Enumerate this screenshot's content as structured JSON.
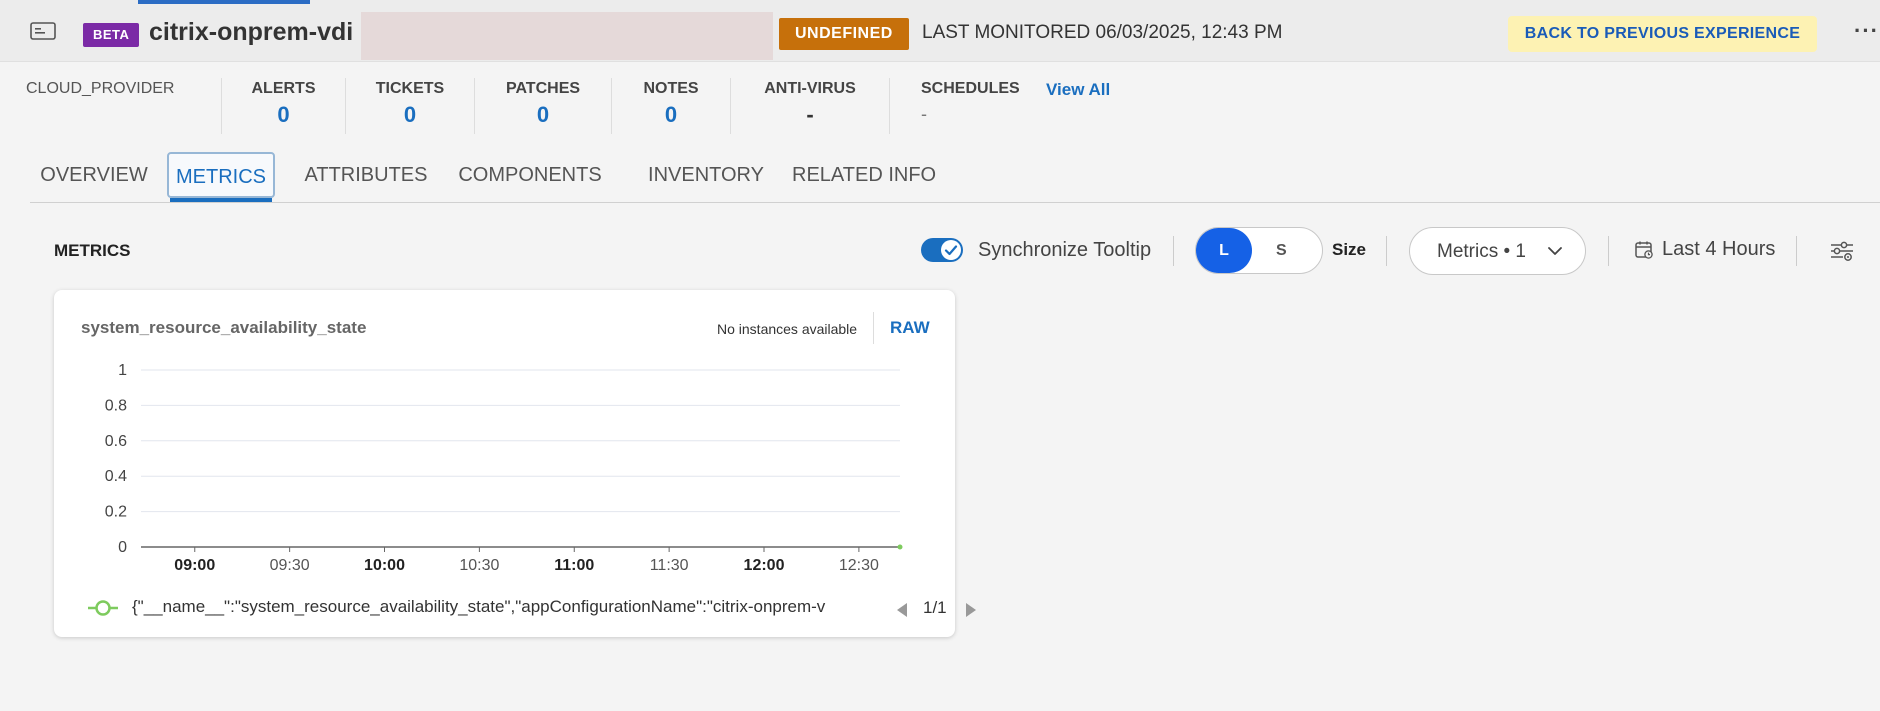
{
  "header": {
    "beta_label": "BETA",
    "device_title": "citrix-onprem-vdi",
    "state_badge": "UNDEFINED",
    "last_monitored": "LAST MONITORED 06/03/2025, 12:43 PM",
    "back_button": "BACK TO PREVIOUS EXPERIENCE",
    "more_icon": "···"
  },
  "summary": {
    "cloud_provider": "CLOUD_PROVIDER",
    "items": [
      {
        "label": "ALERTS",
        "value": "0"
      },
      {
        "label": "TICKETS",
        "value": "0"
      },
      {
        "label": "PATCHES",
        "value": "0"
      },
      {
        "label": "NOTES",
        "value": "0"
      },
      {
        "label": "ANTI-VIRUS",
        "value": "-"
      },
      {
        "label": "SCHEDULES",
        "value": "-"
      }
    ],
    "view_all": "View All"
  },
  "tabs": [
    {
      "label": "OVERVIEW"
    },
    {
      "label": "METRICS"
    },
    {
      "label": "ATTRIBUTES"
    },
    {
      "label": "COMPONENTS"
    },
    {
      "label": "INVENTORY"
    },
    {
      "label": "RELATED INFO"
    }
  ],
  "active_tab": "METRICS",
  "toolbar": {
    "heading": "METRICS",
    "sync_tooltip": "Synchronize Tooltip",
    "sync_on": true,
    "size_l": "L",
    "size_s": "S",
    "size_label": "Size",
    "size_selected": "L",
    "metrics_dropdown": "Metrics • 1",
    "time_range": "Last 4 Hours"
  },
  "card": {
    "title": "system_resource_availability_state",
    "no_instances": "No instances available",
    "raw_button": "RAW",
    "legend_text": "{\"__name__\":\"system_resource_availability_state\",\"appConfigurationName\":\"citrix-onprem-v",
    "pager": "1/1"
  },
  "colors": {
    "accent": "#1a6ebf",
    "beta": "#7b2aa6",
    "state_undefined": "#c6700b",
    "back_button_bg": "#fdf2b3",
    "series": "#7ecb5e"
  },
  "chart_data": {
    "type": "line",
    "title": "system_resource_availability_state",
    "xlabel": "",
    "ylabel": "",
    "ylim": [
      0,
      1
    ],
    "y_ticks": [
      "0",
      "0.2",
      "0.4",
      "0.6",
      "0.8",
      "1"
    ],
    "x_ticks": [
      {
        "label": "09:00",
        "bold": true
      },
      {
        "label": "09:30",
        "bold": false
      },
      {
        "label": "10:00",
        "bold": true
      },
      {
        "label": "10:30",
        "bold": false
      },
      {
        "label": "11:00",
        "bold": true
      },
      {
        "label": "11:30",
        "bold": false
      },
      {
        "label": "12:00",
        "bold": true
      },
      {
        "label": "12:30",
        "bold": false
      }
    ],
    "x_range": [
      "08:43",
      "12:43"
    ],
    "grid": true,
    "legend_position": "bottom",
    "series": [
      {
        "x": [
          "12:43"
        ],
        "values": [
          0
        ]
      }
    ]
  }
}
